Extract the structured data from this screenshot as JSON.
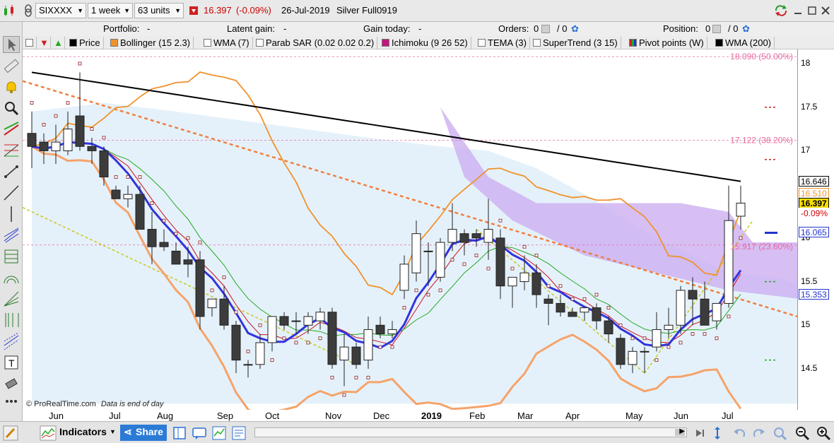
{
  "topbar": {
    "symbol": "SIXXXX",
    "timeframe": "1 week",
    "units": "63 units",
    "price": "16.397",
    "change": "(-0.09%)",
    "date": "26-Jul-2019",
    "instrument": "Silver Full0919"
  },
  "infobar": {
    "portfolio_label": "Portfolio:",
    "portfolio_value": "-",
    "latent_label": "Latent gain:",
    "latent_value": "-",
    "today_label": "Gain today:",
    "today_value": "-",
    "orders_label": "Orders:",
    "orders_value": "0",
    "orders_sep": "/ 0",
    "position_label": "Position:",
    "position_value": "0",
    "position_sep": "/ 0"
  },
  "indicators": [
    {
      "label": "Price",
      "color": "#000000"
    },
    {
      "label": "Bollinger (15 2.3)",
      "color": "#f0922c"
    },
    {
      "label": "WMA (7)",
      "color": "#ffffff"
    },
    {
      "label": "Parab SAR (0.02 0.02 0.2)",
      "color": "#ffffff"
    },
    {
      "label": "Ichimoku (9 26 52)",
      "color": "#c0177b"
    },
    {
      "label": "TEMA (3)",
      "color": "#ffffff"
    },
    {
      "label": "SuperTrend (3 15)",
      "color": "#ffffff"
    },
    {
      "label": "Pivot points (W)",
      "color": "#7a1fbf"
    },
    {
      "label": "WMA (200)",
      "color": "#000000"
    }
  ],
  "yaxis": {
    "ticks": [
      "18",
      "17.5",
      "17",
      "16.5",
      "16",
      "15.5",
      "15",
      "14.5"
    ],
    "tags": {
      "wma200": "16.646",
      "bollinger_upper": "16.510",
      "last_price": "16.397",
      "last_change": "-0.09%",
      "pivot": "16.065",
      "bollinger_mid": "15.353"
    }
  },
  "fib_labels": {
    "fib50": "18.090 (50.00%)",
    "fib382": "17.122 (38.20%)",
    "fib236": "15.917 (23.60%)"
  },
  "xaxis": [
    "Jun",
    "Jul",
    "Aug",
    "Sep",
    "Oct",
    "Nov",
    "Dec",
    "2019",
    "Feb",
    "Mar",
    "Apr",
    "May",
    "Jun",
    "Jul"
  ],
  "credit": {
    "site": "© ProRealTime.com",
    "note": "Data is end of day"
  },
  "bottombar": {
    "indicators_label": "Indicators",
    "share_label": "Share"
  },
  "colors": {
    "bull": "#ffffff",
    "bear": "#3c3c3c",
    "bollinger": "#f0922c",
    "bollinger_lower": "#f5a36a",
    "wma200": "#000000",
    "wma7": "#3333dd",
    "tema": "#cc1020",
    "kijun": "#22aa22",
    "cloud_blue": "#cfe6f5",
    "cloud_purple": "#c9a9f0",
    "sar": "#8b1a1a",
    "fib": "#e56aa0"
  },
  "chart_data": {
    "type": "candlestick",
    "title": "",
    "x_labels": [
      "Jun",
      "Jul",
      "Aug",
      "Sep",
      "Oct",
      "Nov",
      "Dec",
      "2019",
      "Feb",
      "Mar",
      "Apr",
      "May",
      "Jun",
      "Jul"
    ],
    "ylim": [
      14.1,
      18.3
    ],
    "candles": [
      {
        "o": 17.2,
        "h": 17.45,
        "l": 16.8,
        "c": 17.05
      },
      {
        "o": 17.1,
        "h": 17.2,
        "l": 16.85,
        "c": 17.0
      },
      {
        "o": 17.0,
        "h": 17.3,
        "l": 16.85,
        "c": 17.1
      },
      {
        "o": 17.0,
        "h": 17.45,
        "l": 16.95,
        "c": 17.25
      },
      {
        "o": 17.4,
        "h": 17.9,
        "l": 17.0,
        "c": 17.05
      },
      {
        "o": 17.05,
        "h": 17.15,
        "l": 16.85,
        "c": 17.0
      },
      {
        "o": 17.0,
        "h": 17.05,
        "l": 16.6,
        "c": 16.7
      },
      {
        "o": 16.55,
        "h": 16.6,
        "l": 16.45,
        "c": 16.45
      },
      {
        "o": 16.45,
        "h": 16.6,
        "l": 16.35,
        "c": 16.5
      },
      {
        "o": 16.5,
        "h": 16.6,
        "l": 16.1,
        "c": 16.1
      },
      {
        "o": 16.1,
        "h": 16.3,
        "l": 15.7,
        "c": 15.9
      },
      {
        "o": 15.95,
        "h": 16.1,
        "l": 15.85,
        "c": 15.9
      },
      {
        "o": 15.85,
        "h": 15.95,
        "l": 15.7,
        "c": 15.7
      },
      {
        "o": 15.75,
        "h": 15.9,
        "l": 15.55,
        "c": 15.7
      },
      {
        "o": 15.75,
        "h": 15.85,
        "l": 14.95,
        "c": 15.1
      },
      {
        "o": 15.2,
        "h": 15.3,
        "l": 15.1,
        "c": 15.3
      },
      {
        "o": 15.3,
        "h": 15.45,
        "l": 14.95,
        "c": 15.0
      },
      {
        "o": 15.0,
        "h": 15.05,
        "l": 14.45,
        "c": 14.6
      },
      {
        "o": 14.55,
        "h": 14.6,
        "l": 14.4,
        "c": 14.55
      },
      {
        "o": 14.55,
        "h": 14.9,
        "l": 14.5,
        "c": 14.8
      },
      {
        "o": 14.8,
        "h": 15.1,
        "l": 14.7,
        "c": 15.1
      },
      {
        "o": 15.1,
        "h": 15.15,
        "l": 14.95,
        "c": 15.0
      },
      {
        "o": 15.05,
        "h": 15.15,
        "l": 14.9,
        "c": 15.05
      },
      {
        "o": 15.0,
        "h": 15.15,
        "l": 14.9,
        "c": 15.1
      },
      {
        "o": 15.05,
        "h": 15.2,
        "l": 14.95,
        "c": 15.15
      },
      {
        "o": 15.15,
        "h": 15.2,
        "l": 14.5,
        "c": 14.55
      },
      {
        "o": 14.6,
        "h": 14.9,
        "l": 14.3,
        "c": 14.75
      },
      {
        "o": 14.75,
        "h": 14.8,
        "l": 14.5,
        "c": 14.55
      },
      {
        "o": 14.6,
        "h": 15.1,
        "l": 14.5,
        "c": 14.95
      },
      {
        "o": 15.0,
        "h": 15.1,
        "l": 14.85,
        "c": 14.9
      },
      {
        "o": 14.9,
        "h": 15.05,
        "l": 14.85,
        "c": 14.95
      },
      {
        "o": 15.4,
        "h": 15.8,
        "l": 15.3,
        "c": 15.7
      },
      {
        "o": 15.6,
        "h": 16.2,
        "l": 15.5,
        "c": 16.05
      },
      {
        "o": 15.85,
        "h": 15.95,
        "l": 15.45,
        "c": 15.85
      },
      {
        "o": 15.55,
        "h": 16.0,
        "l": 15.5,
        "c": 15.95
      },
      {
        "o": 15.95,
        "h": 16.4,
        "l": 15.85,
        "c": 16.1
      },
      {
        "o": 16.05,
        "h": 16.1,
        "l": 15.8,
        "c": 15.95
      },
      {
        "o": 16.05,
        "h": 16.1,
        "l": 15.9,
        "c": 16.0
      },
      {
        "o": 15.95,
        "h": 16.45,
        "l": 15.75,
        "c": 16.1
      },
      {
        "o": 16.0,
        "h": 16.1,
        "l": 15.3,
        "c": 15.45
      },
      {
        "o": 15.45,
        "h": 15.55,
        "l": 15.2,
        "c": 15.55
      },
      {
        "o": 15.5,
        "h": 15.8,
        "l": 15.4,
        "c": 15.6
      },
      {
        "o": 15.6,
        "h": 15.7,
        "l": 15.2,
        "c": 15.35
      },
      {
        "o": 15.3,
        "h": 15.35,
        "l": 15.0,
        "c": 15.25
      },
      {
        "o": 15.25,
        "h": 15.35,
        "l": 15.1,
        "c": 15.15
      },
      {
        "o": 15.15,
        "h": 15.2,
        "l": 15.1,
        "c": 15.1
      },
      {
        "o": 15.15,
        "h": 15.2,
        "l": 15.05,
        "c": 15.2
      },
      {
        "o": 15.2,
        "h": 15.25,
        "l": 14.95,
        "c": 15.05
      },
      {
        "o": 15.05,
        "h": 15.1,
        "l": 14.8,
        "c": 14.9
      },
      {
        "o": 14.85,
        "h": 14.9,
        "l": 14.5,
        "c": 14.55
      },
      {
        "o": 14.55,
        "h": 14.75,
        "l": 14.45,
        "c": 14.7
      },
      {
        "o": 14.7,
        "h": 14.75,
        "l": 14.45,
        "c": 14.7
      },
      {
        "o": 14.75,
        "h": 15.15,
        "l": 14.7,
        "c": 14.95
      },
      {
        "o": 14.95,
        "h": 15.2,
        "l": 14.85,
        "c": 15.0
      },
      {
        "o": 15.0,
        "h": 15.45,
        "l": 14.9,
        "c": 15.4
      },
      {
        "o": 15.4,
        "h": 15.55,
        "l": 15.0,
        "c": 15.3
      },
      {
        "o": 15.3,
        "h": 15.5,
        "l": 15.0,
        "c": 15.0
      },
      {
        "o": 15.05,
        "h": 15.2,
        "l": 14.95,
        "c": 15.25
      },
      {
        "o": 15.25,
        "h": 16.6,
        "l": 15.2,
        "c": 16.2
      },
      {
        "o": 16.25,
        "h": 16.6,
        "l": 16.1,
        "c": 16.4
      }
    ]
  }
}
